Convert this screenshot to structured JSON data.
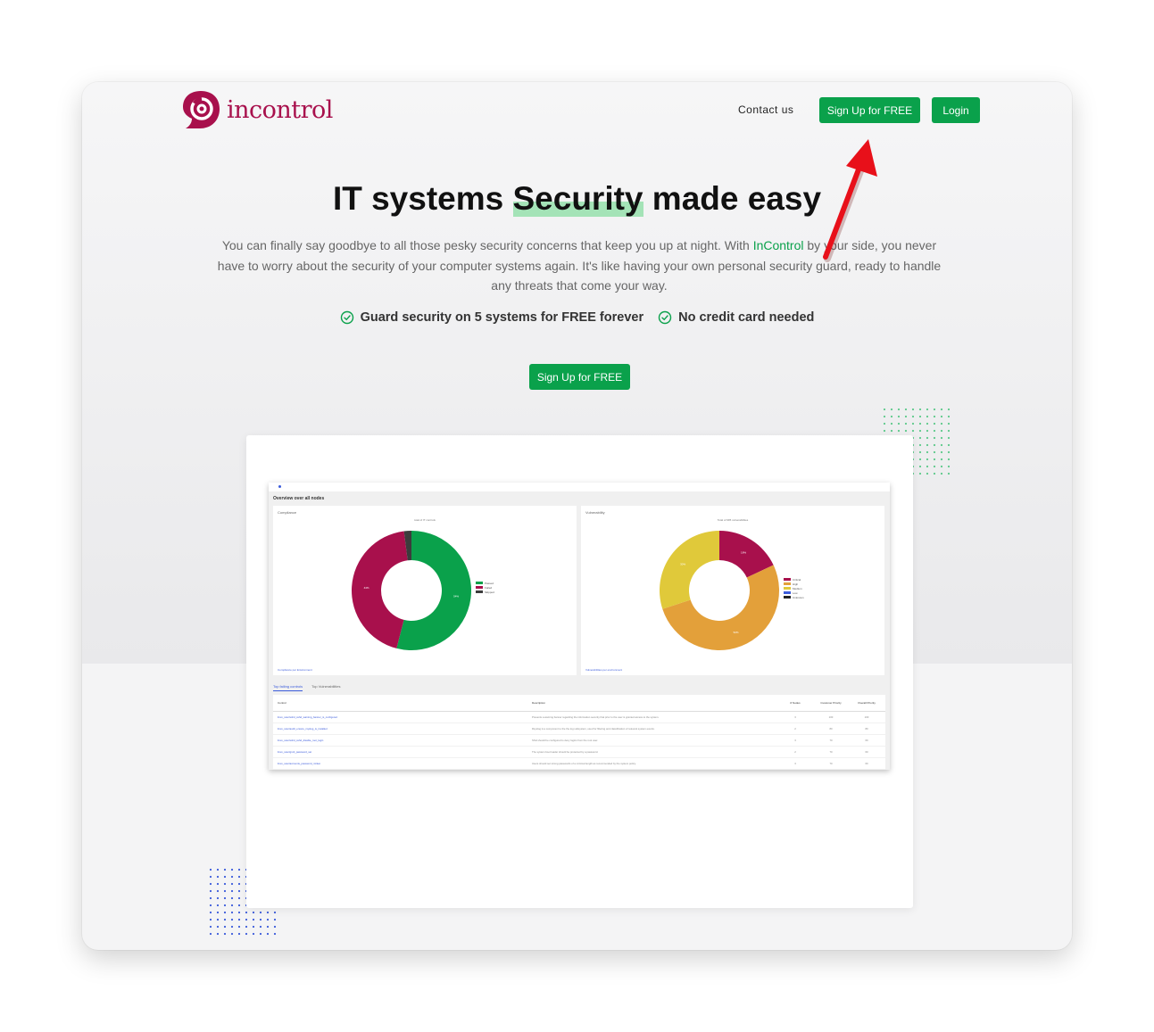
{
  "brand": {
    "name": "incontrol"
  },
  "nav": {
    "contact": "Contact us",
    "signup": "Sign Up for FREE",
    "login": "Login"
  },
  "hero": {
    "title_pre": "IT systems ",
    "title_highlight": "Security",
    "title_post": " made easy",
    "desc_pre": "You can finally say goodbye to all those pesky security concerns that keep you up at night. With ",
    "desc_brand": "InControl",
    "desc_post": " by your side, you never have to worry about the security of your computer systems again. It's like having your own personal security guard, ready to handle any threats that come your way.",
    "features": [
      "Guard security on 5 systems for FREE forever",
      "No credit card needed"
    ],
    "cta": "Sign Up for FREE"
  },
  "colors": {
    "accent": "#0aa14b",
    "brand": "#a8104c",
    "annotation_arrow": "#e8101a"
  },
  "dashboard": {
    "title": "Overview over all nodes",
    "compliance": {
      "label": "Compliance",
      "subtitle": "total of IT controls",
      "footer": "Compliance per Environment",
      "legend": [
        "Passed",
        "Failed",
        "Skipped"
      ]
    },
    "vulnerability": {
      "label": "Vulnerability",
      "subtitle": "Total of 995 vulnerabilities",
      "footer": "Vulnerabilities per environment",
      "legend": [
        "Critical",
        "High",
        "Medium",
        "Low",
        "Unknown"
      ]
    },
    "tabs": [
      "Top failing controls",
      "Top Vulnerabilities"
    ],
    "table": {
      "headers": [
        "Control",
        "Description",
        "# Nodes",
        "Customer Priority",
        "Overall Priority"
      ],
      "rows": [
        [
          "linux_sssc/sshd_sshd_warning_banner_is_configured",
          "Presents a warning banner regarding the information security that prior to the user is granted access to the system.",
          "3",
          "100",
          "100"
        ],
        [
          "linux_sssc/audit_ensure_rsyslog_is_installed",
          "Rsyslog is a component to the the log subsystem, used for filtering and classification of relevant system events.",
          "2",
          "80",
          "80"
        ],
        [
          "linux_sssc/sshd_sshd_disable_root_login",
          "SSH should be configured to deny logins from the root user.",
          "3",
          "70",
          "60"
        ],
        [
          "linux_sssc/grub_password_set",
          "The system boot loader should be protected by a password.",
          "2",
          "70",
          "60"
        ],
        [
          "linux_sssc/accounts_password_minlen",
          "Users should set strong passwords of a minimal length as recommended by the system policy.",
          "3",
          "70",
          "60"
        ]
      ]
    }
  },
  "chart_data": [
    {
      "type": "pie",
      "title": "total of IT controls",
      "categories": [
        "Passed",
        "Failed",
        "Skipped"
      ],
      "values": [
        54,
        44,
        2
      ],
      "colors": [
        "#0aa14b",
        "#a8104c",
        "#3c3c3c"
      ]
    },
    {
      "type": "pie",
      "title": "Total of 995 vulnerabilities",
      "categories": [
        "Critical",
        "High",
        "Medium"
      ],
      "values": [
        18,
        52,
        30
      ],
      "colors": [
        "#a8104c",
        "#e3a03a",
        "#e0c93a"
      ]
    }
  ]
}
